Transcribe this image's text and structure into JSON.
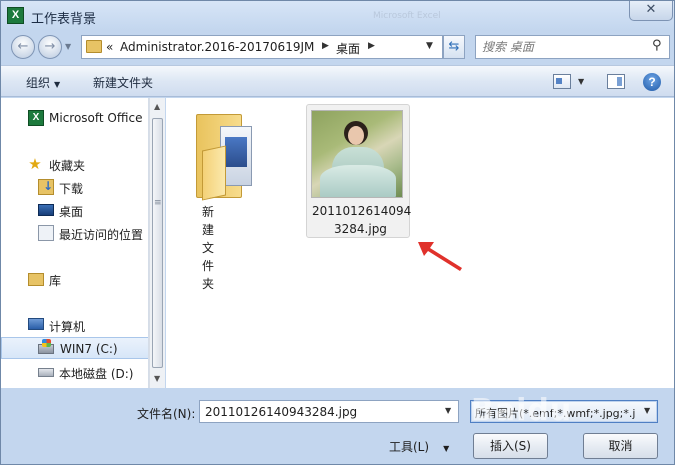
{
  "window": {
    "title": "工作表背景",
    "ghost_title_1": "",
    "ghost_title_2": "Microsoft Excel",
    "close_label": "✕"
  },
  "nav": {
    "back_icon": "back-arrow-icon",
    "forward_icon": "forward-arrow-icon",
    "address_prefix": "«",
    "address_parts": [
      "Administrator.2016-20170619JM",
      "桌面"
    ],
    "search_placeholder": "搜索 桌面"
  },
  "toolbar": {
    "organize": "组织",
    "new_folder": "新建文件夹",
    "help_label": "?"
  },
  "sidebar": {
    "items": [
      {
        "label": "Microsoft Office",
        "icon": "office-icon"
      },
      {
        "label": "收藏夹",
        "icon": "star-icon"
      },
      {
        "label": "下载",
        "icon": "download-folder-icon"
      },
      {
        "label": "桌面",
        "icon": "desktop-icon"
      },
      {
        "label": "最近访问的位置",
        "icon": "recent-places-icon"
      },
      {
        "label": "库",
        "icon": "library-icon"
      },
      {
        "label": "计算机",
        "icon": "computer-icon"
      },
      {
        "label": "WIN7 (C:)",
        "icon": "system-drive-icon"
      },
      {
        "label": "本地磁盘 (D:)",
        "icon": "local-disk-icon"
      }
    ]
  },
  "files": [
    {
      "name": "新建文件夹",
      "type": "folder",
      "icon": "folder-icon"
    },
    {
      "name_line1": "2011012614094",
      "name_line2": "3284.jpg",
      "type": "image",
      "selected": true,
      "icon": "image-thumbnail"
    }
  ],
  "bottom": {
    "filename_label": "文件名(N):",
    "filename_value": "20110126140943284.jpg",
    "filter_value": "所有图片(*.emf;*.wmf;*.jpg;*.j",
    "tools_label": "工具(L)",
    "insert_label": "插入(S)",
    "cancel_label": "取消"
  },
  "watermark": "Baidu",
  "colors": {
    "accent": "#2f6fb8",
    "annotation_arrow": "#e0312b",
    "selection": "#f1f1f1"
  }
}
